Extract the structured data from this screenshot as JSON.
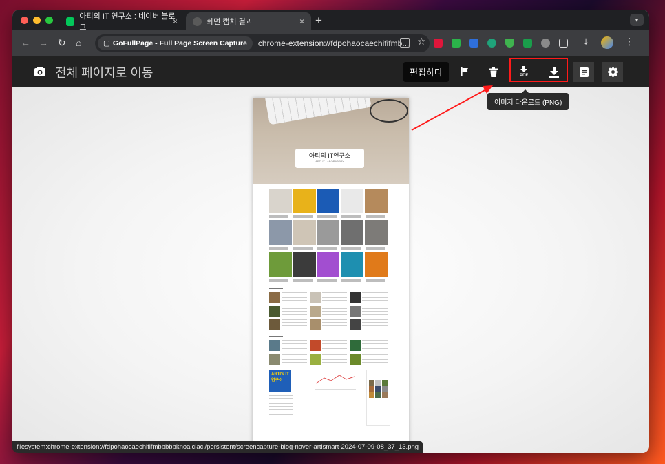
{
  "tabs": [
    {
      "title": "아티의 IT 연구소 : 네이버 블로그",
      "close": "×",
      "active": false
    },
    {
      "title": "화면 캡처 결과",
      "close": "×",
      "active": true
    }
  ],
  "new_tab": "+",
  "omnibox": {
    "extension_chip": "GoFullPage - Full Page Screen Capture",
    "url": "chrome-extension://fdpohaocaechififmb..."
  },
  "app": {
    "title": "전체 페이지로 이동",
    "edit_label": "편집하다",
    "pdf_label": "PDF",
    "tooltip": "이미지 다운로드 (PNG)"
  },
  "preview": {
    "logo_text": "아티의 IT연구소",
    "logo_sub": "ARTI IT LABORATORY",
    "footer_logo": "ARTI's IT 연구소"
  },
  "status_url": "filesystem:chrome-extension://fdpohaocaechififmbbbbbknoalclacl/persistent/screencapture-blog-naver-artismart-2024-07-09-08_37_13.png",
  "colors": {
    "tooltip_bg": "#2b2b2b",
    "highlight": "#ff1a1a",
    "header_bg": "#222222"
  },
  "icons": [
    "camera-icon",
    "flag-icon",
    "trash-icon",
    "pdf-download-icon",
    "download-icon",
    "document-icon",
    "gear-icon",
    "star-icon",
    "translate-icon",
    "extensions-icon",
    "profile-icon"
  ]
}
